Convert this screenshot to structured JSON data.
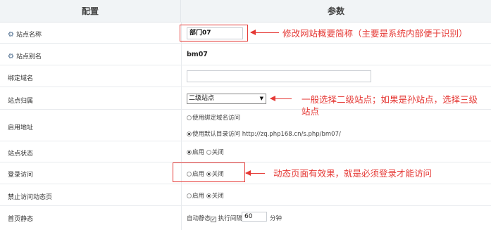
{
  "header": {
    "col1": "配置",
    "col2": "参数"
  },
  "rows": {
    "site_name": {
      "label": "站点名称",
      "value": "部门07"
    },
    "site_alias": {
      "label": "站点别名",
      "value": "bm07"
    },
    "bind_domain": {
      "label": "绑定域名",
      "value": ""
    },
    "site_parent": {
      "label": "站点归属",
      "value": "二级站点"
    },
    "enable_addr": {
      "label": "启用地址",
      "opt1": "使用绑定域名访问",
      "opt2": "使用默认目录访问 http://zq.php168.cn/s.php/bm07/"
    },
    "site_status": {
      "label": "站点状态",
      "on": "启用",
      "off": "关闭"
    },
    "login_access": {
      "label": "登录访问",
      "on": "启用",
      "off": "关闭"
    },
    "forbid_dynamic": {
      "label": "禁止访问动态页",
      "on": "启用",
      "off": "关闭"
    },
    "home_static": {
      "label": "首页静态",
      "auto": "自动静态",
      "interval_label": "执行间隔",
      "interval_value": "60",
      "unit": "分钟"
    }
  },
  "notes": {
    "n1": "修改网站概要简称（主要是系统内部便于识别）",
    "n2_line1": "一般选择二级站点；如果是孙站点，选择三级",
    "n2_line2": "站点",
    "n3": "动态页面有效果，就是必须登录才能访问"
  },
  "colors": {
    "accent": "#e53935",
    "header_bg": "#f1f4f6"
  }
}
